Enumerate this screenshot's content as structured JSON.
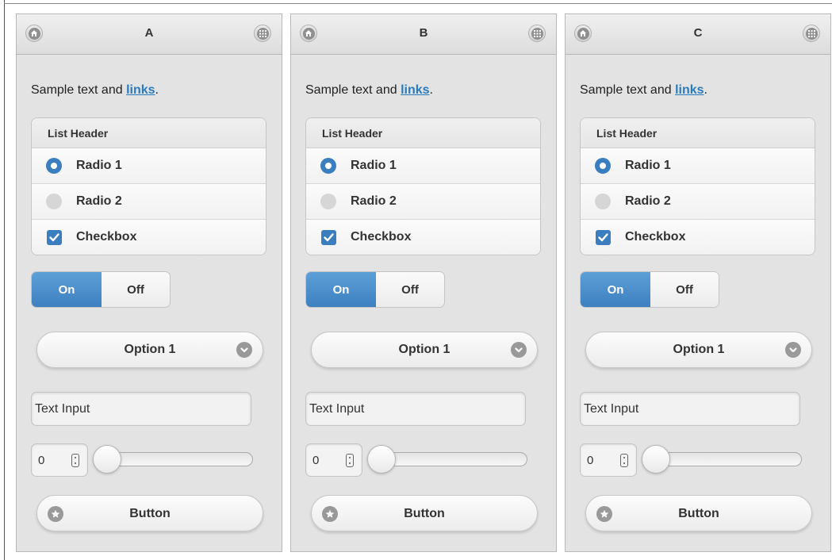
{
  "panels": [
    {
      "title": "A",
      "sample_text": "Sample text and ",
      "link_text": "links",
      "sample_suffix": ".",
      "list_header": "List Header",
      "radio1_label": "Radio 1",
      "radio2_label": "Radio 2",
      "checkbox_label": "Checkbox",
      "flip_on": "On",
      "flip_off": "Off",
      "select_value": "Option 1",
      "text_input_placeholder": "Text Input",
      "slider_value": "0",
      "button_label": "Button"
    },
    {
      "title": "B",
      "sample_text": "Sample text and ",
      "link_text": "links",
      "sample_suffix": ".",
      "list_header": "List Header",
      "radio1_label": "Radio 1",
      "radio2_label": "Radio 2",
      "checkbox_label": "Checkbox",
      "flip_on": "On",
      "flip_off": "Off",
      "select_value": "Option 1",
      "text_input_placeholder": "Text Input",
      "slider_value": "0",
      "button_label": "Button"
    },
    {
      "title": "C",
      "sample_text": "Sample text and ",
      "link_text": "links",
      "sample_suffix": ".",
      "list_header": "List Header",
      "radio1_label": "Radio 1",
      "radio2_label": "Radio 2",
      "checkbox_label": "Checkbox",
      "flip_on": "On",
      "flip_off": "Off",
      "select_value": "Option 1",
      "text_input_placeholder": "Text Input",
      "slider_value": "0",
      "button_label": "Button"
    }
  ],
  "icons": {
    "header_left": "home-icon",
    "header_right": "grid-icon",
    "select": "chevron-down-icon",
    "button": "star-icon",
    "radio_selected": "radio-selected-icon",
    "radio_unselected": "radio-unselected-icon",
    "checkbox": "checkbox-checked-icon"
  },
  "colors": {
    "accent": "#3a7ec0",
    "link": "#2a7bbd",
    "panel_bg": "#e3e3e3",
    "header_bg": "#dcdcdc"
  }
}
